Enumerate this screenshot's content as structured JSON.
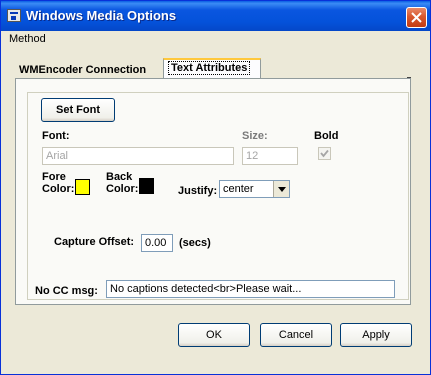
{
  "window": {
    "title": "Windows Media Options"
  },
  "menu": {
    "items": [
      "Method"
    ]
  },
  "tabs": [
    {
      "label": "WMEncoder Connection",
      "active": false
    },
    {
      "label": "Text Attributes",
      "active": true
    }
  ],
  "text_attributes": {
    "set_font_label": "Set Font",
    "font_label": "Font:",
    "font_value": "Arial",
    "size_label": "Size:",
    "size_value": "12",
    "bold_label": "Bold",
    "bold_checked": true,
    "fore_color_label_1": "Fore",
    "fore_color_label_2": "Color:",
    "fore_color": "#ffff00",
    "back_color_label_1": "Back",
    "back_color_label_2": "Color:",
    "back_color": "#000000",
    "justify_label": "Justify:",
    "justify_value": "center",
    "capture_offset_label": "Capture Offset:",
    "capture_offset_value": "0.00",
    "capture_offset_unit": "(secs)",
    "no_cc_label": "No CC msg:",
    "no_cc_value": "No captions detected<br>Please wait..."
  },
  "buttons": {
    "ok": "OK",
    "cancel": "Cancel",
    "apply": "Apply"
  },
  "icons": {
    "app": "media-options-icon",
    "close": "close-icon",
    "dropdown": "chevron-down-icon",
    "check": "check-icon"
  }
}
